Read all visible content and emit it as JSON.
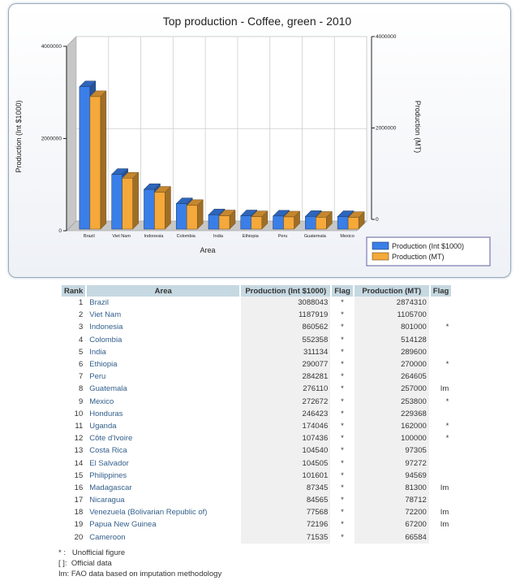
{
  "chart_data": {
    "type": "bar",
    "title": "Top production - Coffee, green - 2010",
    "xlabel": "Area",
    "ylabel": "Production (Int $1000)",
    "ylabel_right": "Production (MT)",
    "categories": [
      "Brazil",
      "Viet Nam",
      "Indonesia",
      "Colombia",
      "India",
      "Ethiopia",
      "Peru",
      "Guatemala",
      "Mexico"
    ],
    "ylim": [
      0,
      4000000
    ],
    "yticks": [
      "0",
      "2000000",
      "4000000"
    ],
    "ylim_right": [
      0,
      4000000
    ],
    "yticks_right": [
      "0",
      "2000000",
      "4000000"
    ],
    "grid": true,
    "legend_position": "bottom-right",
    "series": [
      {
        "name": "Production (Int $1000)",
        "color": "#3a7ee8",
        "values": [
          3088043,
          1187919,
          860562,
          552358,
          311134,
          290077,
          284281,
          276110,
          272672
        ]
      },
      {
        "name": "Production (MT)",
        "color": "#f5a93a",
        "values": [
          2874310,
          1105700,
          801000,
          514128,
          289600,
          270000,
          264605,
          257000,
          253800
        ]
      }
    ]
  },
  "table": {
    "headers": [
      "Rank",
      "Area",
      "Production (Int $1000)",
      "Flag",
      "Production (MT)",
      "Flag"
    ],
    "rows": [
      {
        "rank": "1",
        "area": "Brazil",
        "p_int": "3088043",
        "f1": "*",
        "p_mt": "2874310",
        "f2": ""
      },
      {
        "rank": "2",
        "area": "Viet Nam",
        "p_int": "1187919",
        "f1": "*",
        "p_mt": "1105700",
        "f2": ""
      },
      {
        "rank": "3",
        "area": "Indonesia",
        "p_int": "860562",
        "f1": "*",
        "p_mt": "801000",
        "f2": "*"
      },
      {
        "rank": "4",
        "area": "Colombia",
        "p_int": "552358",
        "f1": "*",
        "p_mt": "514128",
        "f2": ""
      },
      {
        "rank": "5",
        "area": "India",
        "p_int": "311134",
        "f1": "*",
        "p_mt": "289600",
        "f2": ""
      },
      {
        "rank": "6",
        "area": "Ethiopia",
        "p_int": "290077",
        "f1": "*",
        "p_mt": "270000",
        "f2": "*"
      },
      {
        "rank": "7",
        "area": "Peru",
        "p_int": "284281",
        "f1": "*",
        "p_mt": "264605",
        "f2": ""
      },
      {
        "rank": "8",
        "area": "Guatemala",
        "p_int": "276110",
        "f1": "*",
        "p_mt": "257000",
        "f2": "Im"
      },
      {
        "rank": "9",
        "area": "Mexico",
        "p_int": "272672",
        "f1": "*",
        "p_mt": "253800",
        "f2": "*"
      },
      {
        "rank": "10",
        "area": "Honduras",
        "p_int": "246423",
        "f1": "*",
        "p_mt": "229368",
        "f2": ""
      },
      {
        "rank": "11",
        "area": "Uganda",
        "p_int": "174046",
        "f1": "*",
        "p_mt": "162000",
        "f2": "*"
      },
      {
        "rank": "12",
        "area": "Côte d'Ivoire",
        "p_int": "107436",
        "f1": "*",
        "p_mt": "100000",
        "f2": "*"
      },
      {
        "rank": "13",
        "area": "Costa Rica",
        "p_int": "104540",
        "f1": "*",
        "p_mt": "97305",
        "f2": ""
      },
      {
        "rank": "14",
        "area": "El Salvador",
        "p_int": "104505",
        "f1": "*",
        "p_mt": "97272",
        "f2": ""
      },
      {
        "rank": "15",
        "area": "Philippines",
        "p_int": "101601",
        "f1": "*",
        "p_mt": "94569",
        "f2": ""
      },
      {
        "rank": "16",
        "area": "Madagascar",
        "p_int": "87345",
        "f1": "*",
        "p_mt": "81300",
        "f2": "Im"
      },
      {
        "rank": "17",
        "area": "Nicaragua",
        "p_int": "84565",
        "f1": "*",
        "p_mt": "78712",
        "f2": ""
      },
      {
        "rank": "18",
        "area": "Venezuela (Bolivarian Republic of)",
        "p_int": "77568",
        "f1": "*",
        "p_mt": "72200",
        "f2": "Im"
      },
      {
        "rank": "19",
        "area": "Papua New Guinea",
        "p_int": "72196",
        "f1": "*",
        "p_mt": "67200",
        "f2": "Im"
      },
      {
        "rank": "20",
        "area": "Cameroon",
        "p_int": "71535",
        "f1": "*",
        "p_mt": "66584",
        "f2": ""
      }
    ]
  },
  "notes": [
    "* :   Unofficial figure",
    "[ ]:  Official data",
    "Im: FAO data based on imputation methodology"
  ]
}
